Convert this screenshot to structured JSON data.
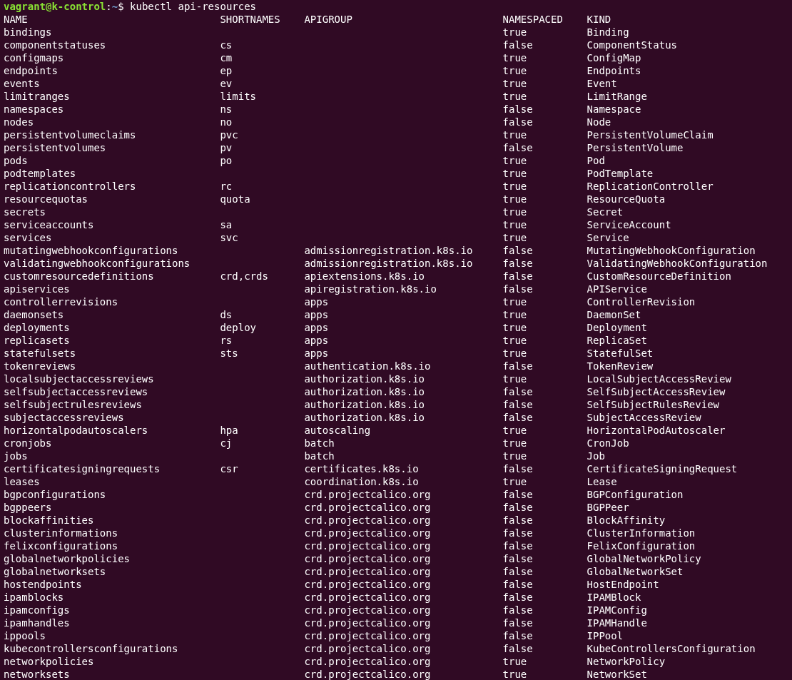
{
  "prompt": {
    "user_host": "vagrant@k-control",
    "separator": ":",
    "path": "~",
    "symbol": "$",
    "command": "kubectl api-resources"
  },
  "table": {
    "columns": [
      "NAME",
      "SHORTNAMES",
      "APIGROUP",
      "NAMESPACED",
      "KIND"
    ],
    "rows": [
      {
        "name": "bindings",
        "namespaced": "true",
        "kind": "Binding"
      },
      {
        "name": "componentstatuses",
        "shortnames": "cs",
        "namespaced": "false",
        "kind": "ComponentStatus"
      },
      {
        "name": "configmaps",
        "shortnames": "cm",
        "namespaced": "true",
        "kind": "ConfigMap"
      },
      {
        "name": "endpoints",
        "shortnames": "ep",
        "namespaced": "true",
        "kind": "Endpoints"
      },
      {
        "name": "events",
        "shortnames": "ev",
        "namespaced": "true",
        "kind": "Event"
      },
      {
        "name": "limitranges",
        "shortnames": "limits",
        "namespaced": "true",
        "kind": "LimitRange"
      },
      {
        "name": "namespaces",
        "shortnames": "ns",
        "namespaced": "false",
        "kind": "Namespace"
      },
      {
        "name": "nodes",
        "shortnames": "no",
        "namespaced": "false",
        "kind": "Node"
      },
      {
        "name": "persistentvolumeclaims",
        "shortnames": "pvc",
        "namespaced": "true",
        "kind": "PersistentVolumeClaim"
      },
      {
        "name": "persistentvolumes",
        "shortnames": "pv",
        "namespaced": "false",
        "kind": "PersistentVolume"
      },
      {
        "name": "pods",
        "shortnames": "po",
        "namespaced": "true",
        "kind": "Pod"
      },
      {
        "name": "podtemplates",
        "namespaced": "true",
        "kind": "PodTemplate"
      },
      {
        "name": "replicationcontrollers",
        "shortnames": "rc",
        "namespaced": "true",
        "kind": "ReplicationController"
      },
      {
        "name": "resourcequotas",
        "shortnames": "quota",
        "namespaced": "true",
        "kind": "ResourceQuota"
      },
      {
        "name": "secrets",
        "namespaced": "true",
        "kind": "Secret"
      },
      {
        "name": "serviceaccounts",
        "shortnames": "sa",
        "namespaced": "true",
        "kind": "ServiceAccount"
      },
      {
        "name": "services",
        "shortnames": "svc",
        "namespaced": "true",
        "kind": "Service"
      },
      {
        "name": "mutatingwebhookconfigurations",
        "apigroup": "admissionregistration.k8s.io",
        "namespaced": "false",
        "kind": "MutatingWebhookConfiguration"
      },
      {
        "name": "validatingwebhookconfigurations",
        "apigroup": "admissionregistration.k8s.io",
        "namespaced": "false",
        "kind": "ValidatingWebhookConfiguration"
      },
      {
        "name": "customresourcedefinitions",
        "shortnames": "crd,crds",
        "apigroup": "apiextensions.k8s.io",
        "namespaced": "false",
        "kind": "CustomResourceDefinition"
      },
      {
        "name": "apiservices",
        "apigroup": "apiregistration.k8s.io",
        "namespaced": "false",
        "kind": "APIService"
      },
      {
        "name": "controllerrevisions",
        "apigroup": "apps",
        "namespaced": "true",
        "kind": "ControllerRevision"
      },
      {
        "name": "daemonsets",
        "shortnames": "ds",
        "apigroup": "apps",
        "namespaced": "true",
        "kind": "DaemonSet"
      },
      {
        "name": "deployments",
        "shortnames": "deploy",
        "apigroup": "apps",
        "namespaced": "true",
        "kind": "Deployment"
      },
      {
        "name": "replicasets",
        "shortnames": "rs",
        "apigroup": "apps",
        "namespaced": "true",
        "kind": "ReplicaSet"
      },
      {
        "name": "statefulsets",
        "shortnames": "sts",
        "apigroup": "apps",
        "namespaced": "true",
        "kind": "StatefulSet"
      },
      {
        "name": "tokenreviews",
        "apigroup": "authentication.k8s.io",
        "namespaced": "false",
        "kind": "TokenReview"
      },
      {
        "name": "localsubjectaccessreviews",
        "apigroup": "authorization.k8s.io",
        "namespaced": "true",
        "kind": "LocalSubjectAccessReview"
      },
      {
        "name": "selfsubjectaccessreviews",
        "apigroup": "authorization.k8s.io",
        "namespaced": "false",
        "kind": "SelfSubjectAccessReview"
      },
      {
        "name": "selfsubjectrulesreviews",
        "apigroup": "authorization.k8s.io",
        "namespaced": "false",
        "kind": "SelfSubjectRulesReview"
      },
      {
        "name": "subjectaccessreviews",
        "apigroup": "authorization.k8s.io",
        "namespaced": "false",
        "kind": "SubjectAccessReview"
      },
      {
        "name": "horizontalpodautoscalers",
        "shortnames": "hpa",
        "apigroup": "autoscaling",
        "namespaced": "true",
        "kind": "HorizontalPodAutoscaler"
      },
      {
        "name": "cronjobs",
        "shortnames": "cj",
        "apigroup": "batch",
        "namespaced": "true",
        "kind": "CronJob"
      },
      {
        "name": "jobs",
        "apigroup": "batch",
        "namespaced": "true",
        "kind": "Job"
      },
      {
        "name": "certificatesigningrequests",
        "shortnames": "csr",
        "apigroup": "certificates.k8s.io",
        "namespaced": "false",
        "kind": "CertificateSigningRequest"
      },
      {
        "name": "leases",
        "apigroup": "coordination.k8s.io",
        "namespaced": "true",
        "kind": "Lease"
      },
      {
        "name": "bgpconfigurations",
        "apigroup": "crd.projectcalico.org",
        "namespaced": "false",
        "kind": "BGPConfiguration"
      },
      {
        "name": "bgppeers",
        "apigroup": "crd.projectcalico.org",
        "namespaced": "false",
        "kind": "BGPPeer"
      },
      {
        "name": "blockaffinities",
        "apigroup": "crd.projectcalico.org",
        "namespaced": "false",
        "kind": "BlockAffinity"
      },
      {
        "name": "clusterinformations",
        "apigroup": "crd.projectcalico.org",
        "namespaced": "false",
        "kind": "ClusterInformation"
      },
      {
        "name": "felixconfigurations",
        "apigroup": "crd.projectcalico.org",
        "namespaced": "false",
        "kind": "FelixConfiguration"
      },
      {
        "name": "globalnetworkpolicies",
        "apigroup": "crd.projectcalico.org",
        "namespaced": "false",
        "kind": "GlobalNetworkPolicy"
      },
      {
        "name": "globalnetworksets",
        "apigroup": "crd.projectcalico.org",
        "namespaced": "false",
        "kind": "GlobalNetworkSet"
      },
      {
        "name": "hostendpoints",
        "apigroup": "crd.projectcalico.org",
        "namespaced": "false",
        "kind": "HostEndpoint"
      },
      {
        "name": "ipamblocks",
        "apigroup": "crd.projectcalico.org",
        "namespaced": "false",
        "kind": "IPAMBlock"
      },
      {
        "name": "ipamconfigs",
        "apigroup": "crd.projectcalico.org",
        "namespaced": "false",
        "kind": "IPAMConfig"
      },
      {
        "name": "ipamhandles",
        "apigroup": "crd.projectcalico.org",
        "namespaced": "false",
        "kind": "IPAMHandle"
      },
      {
        "name": "ippools",
        "apigroup": "crd.projectcalico.org",
        "namespaced": "false",
        "kind": "IPPool"
      },
      {
        "name": "kubecontrollersconfigurations",
        "apigroup": "crd.projectcalico.org",
        "namespaced": "false",
        "kind": "KubeControllersConfiguration"
      },
      {
        "name": "networkpolicies",
        "apigroup": "crd.projectcalico.org",
        "namespaced": "true",
        "kind": "NetworkPolicy"
      },
      {
        "name": "networksets",
        "apigroup": "crd.projectcalico.org",
        "namespaced": "true",
        "kind": "NetworkSet"
      }
    ]
  }
}
